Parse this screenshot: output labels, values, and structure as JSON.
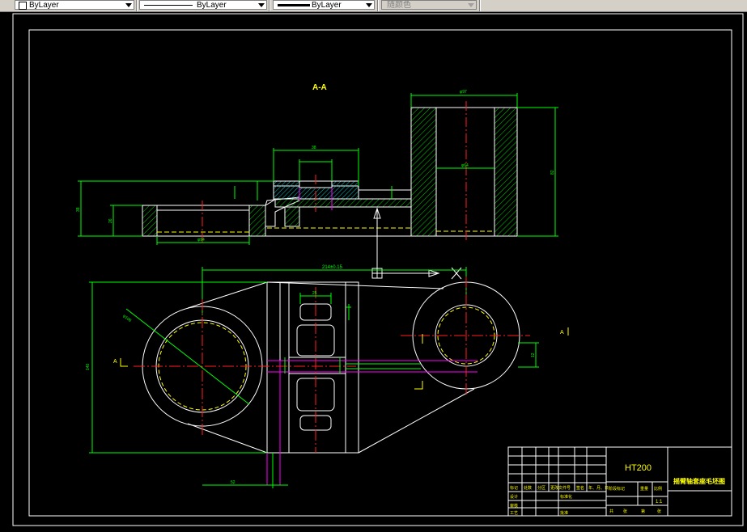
{
  "toolbar": {
    "color_control": "ByLayer",
    "linetype_control": "ByLayer",
    "lineweight_control": "ByLayer",
    "plotstyle_control": "随颜色"
  },
  "drawing": {
    "section_title": "A-A",
    "overall_dim": "214±0.15",
    "left_view_label": "A",
    "right_view_label": "A",
    "title_block": {
      "material": "HT200",
      "part_name": "摇臂轴套座毛坯图",
      "scale": "1:1",
      "cells": [
        "标记",
        "处数",
        "分区",
        "更改文件号",
        "签名",
        "年、月、日",
        "设计",
        "标准化",
        "审核",
        "工艺",
        "批准",
        "阶段标记",
        "重量",
        "比例",
        "共",
        "张",
        "第",
        "张"
      ]
    },
    "dims": {
      "top_width": "φ97",
      "right_height": "82",
      "hub_bore": "φ64",
      "slot_width": "38",
      "left_height": "38",
      "left_step": "26",
      "left_bore": "φ94",
      "hole_dia": "φ108",
      "left_overall": "140",
      "bottom_dim": "52",
      "pocket_dim": "25",
      "right_small": "12"
    }
  }
}
